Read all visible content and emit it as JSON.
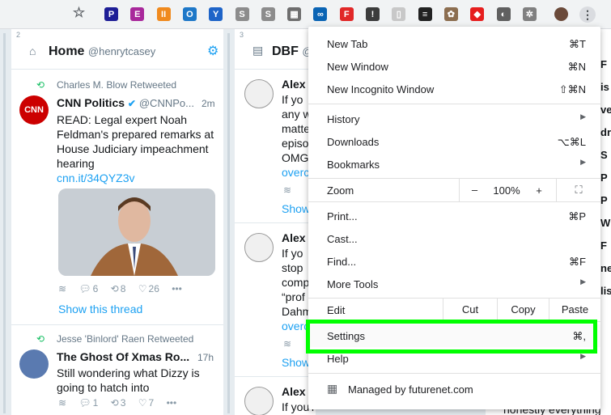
{
  "toolbar": {
    "star": "☆",
    "extensions": [
      {
        "name": "p-icon",
        "glyph": "P",
        "color": "#1e1e96"
      },
      {
        "name": "e-icon",
        "glyph": "E",
        "color": "#a8289b"
      },
      {
        "name": "pause-icon",
        "glyph": "II",
        "color": "#f08a1e"
      },
      {
        "name": "ring-icon",
        "glyph": "O",
        "color": "#1e78c8"
      },
      {
        "name": "y-icon",
        "glyph": "Y",
        "color": "#1e64c8"
      },
      {
        "name": "s-icon",
        "glyph": "S",
        "color": "#8c8c8c"
      },
      {
        "name": "s2-icon",
        "glyph": "S",
        "color": "#8c8c8c"
      },
      {
        "name": "chart-icon",
        "glyph": "▦",
        "color": "#6e6e6e"
      },
      {
        "name": "link-icon",
        "glyph": "∞",
        "color": "#0a64b4"
      },
      {
        "name": "flipboard-icon",
        "glyph": "F",
        "color": "#e12828"
      },
      {
        "name": "info-icon",
        "glyph": "!",
        "color": "#3c3c3c"
      },
      {
        "name": "doc-icon",
        "glyph": "▯",
        "color": "#c8c8c8"
      },
      {
        "name": "buffer-icon",
        "glyph": "≡",
        "color": "#222222"
      },
      {
        "name": "cookie-icon",
        "glyph": "✿",
        "color": "#8c6e50"
      },
      {
        "name": "tag-icon",
        "glyph": "◆",
        "color": "#e61e1e"
      },
      {
        "name": "moon-icon",
        "glyph": "◐",
        "color": "#606060"
      },
      {
        "name": "gear-icon",
        "glyph": "✲",
        "color": "#808080"
      }
    ],
    "kebab": "⋮"
  },
  "column1": {
    "num": "2",
    "title": "Home",
    "handle": "@henrytcasey",
    "tweets": [
      {
        "retweeter": "Charles M. Blow Retweeted",
        "name": "CNN Politics",
        "handle": "@CNNPo...",
        "time": "2m",
        "avatar_text": "CNN",
        "text": "READ: Legal expert Noah Feldman's prepared remarks at House Judiciary impeachment hearing",
        "link": "cnn.it/34QYZ3v",
        "replies": "6",
        "retweets": "8",
        "likes": "26",
        "thread": "Show this thread"
      },
      {
        "retweeter": "Jesse 'Binlord' Raen Retweeted",
        "name": "The Ghost Of Xmas Ro...",
        "time": "17h",
        "text": "Still wondering what Dizzy is going to hatch into",
        "replies": "1",
        "retweets": "3",
        "likes": "7"
      }
    ]
  },
  "column2": {
    "num": "3",
    "title": "DBF",
    "handle": "@",
    "tweets": [
      {
        "name": "Alex",
        "lines": [
          "If yo",
          "any w",
          "matte",
          "episo",
          "OMG"
        ],
        "link": "overc",
        "show": "Show"
      },
      {
        "name": "Alex",
        "lines": [
          "If yo",
          "stop",
          "comp",
          "“prof",
          "Dahm"
        ],
        "link": "overc",
        "show": "Show"
      },
      {
        "name": "Alex",
        "lines": [
          "If you're like me and went to"
        ]
      }
    ]
  },
  "right_strip": {
    "fragments": [
      "F",
      "is",
      "ve",
      "dr",
      "S",
      "P",
      "P",
      "W",
      "F",
      "ne",
      "lis"
    ],
    "bottom": "honestly everything"
  },
  "menu": {
    "new_tab": {
      "label": "New Tab",
      "shortcut": "⌘T"
    },
    "new_window": {
      "label": "New Window",
      "shortcut": "⌘N"
    },
    "incognito": {
      "label": "New Incognito Window",
      "shortcut": "⇧⌘N"
    },
    "history": {
      "label": "History"
    },
    "downloads": {
      "label": "Downloads",
      "shortcut": "⌥⌘L"
    },
    "bookmarks": {
      "label": "Bookmarks"
    },
    "zoom": {
      "label": "Zoom",
      "minus": "–",
      "value": "100%",
      "plus": "+",
      "fullscreen": "⛶"
    },
    "print": {
      "label": "Print...",
      "shortcut": "⌘P"
    },
    "cast": {
      "label": "Cast..."
    },
    "find": {
      "label": "Find...",
      "shortcut": "⌘F"
    },
    "more_tools": {
      "label": "More Tools"
    },
    "edit": {
      "label": "Edit",
      "cut": "Cut",
      "copy": "Copy",
      "paste": "Paste"
    },
    "settings": {
      "label": "Settings",
      "shortcut": "⌘,"
    },
    "help": {
      "label": "Help"
    },
    "managed": {
      "label": "Managed by futurenet.com"
    },
    "submenu_arrow": "▶"
  },
  "colors": {
    "highlight": "#00ff00",
    "twitter_blue": "#1da1f2",
    "retweet_green": "#17bf63"
  }
}
